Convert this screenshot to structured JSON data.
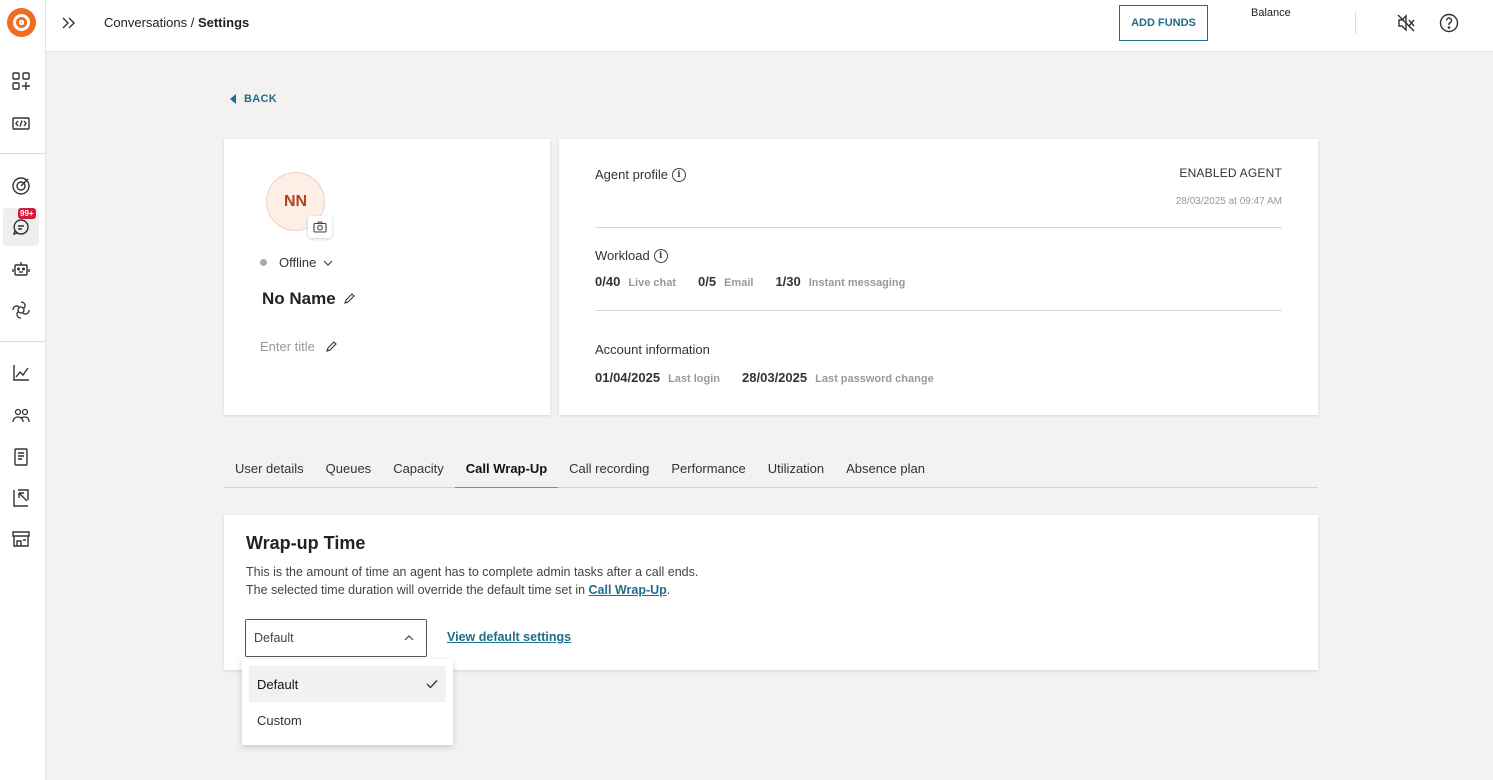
{
  "topbar": {
    "breadcrumb_parent": "Conversations",
    "breadcrumb_separator": " / ",
    "breadcrumb_current": "Settings",
    "add_funds_label": "ADD FUNDS",
    "balance_label": "Balance"
  },
  "sidebar": {
    "badge": "99+",
    "items": [
      "dashboard-icon",
      "code-icon",
      "target-icon",
      "chat-icon",
      "bot-icon",
      "ai-icon",
      "chart-icon",
      "people-icon",
      "book-icon",
      "export-icon",
      "store-icon"
    ]
  },
  "back_label": "BACK",
  "profile": {
    "initials": "NN",
    "status": "Offline",
    "name": "No Name",
    "title_placeholder": "Enter title"
  },
  "info": {
    "agent_profile_label": "Agent profile",
    "enabled_label": "ENABLED AGENT",
    "enabled_date": "28/03/2025 at 09:47 AM",
    "workload_label": "Workload",
    "workload": [
      {
        "value": "0/40",
        "label": "Live chat"
      },
      {
        "value": "0/5",
        "label": "Email"
      },
      {
        "value": "1/30",
        "label": "Instant messaging"
      }
    ],
    "account_label": "Account information",
    "account": [
      {
        "value": "01/04/2025",
        "label": "Last login"
      },
      {
        "value": "28/03/2025",
        "label": "Last password change"
      }
    ]
  },
  "tabs": [
    "User details",
    "Queues",
    "Capacity",
    "Call Wrap-Up",
    "Call recording",
    "Performance",
    "Utilization",
    "Absence plan"
  ],
  "active_tab": "Call Wrap-Up",
  "wrapup": {
    "title": "Wrap-up Time",
    "desc_line1": "This is the amount of time an agent has to complete admin tasks after a call ends.",
    "desc_line2_prefix": "The selected time duration will override the default time set in ",
    "desc_link": "Call Wrap-Up",
    "desc_line2_suffix": ".",
    "select_value": "Default",
    "view_default_link": "View default settings",
    "options": [
      "Default",
      "Custom"
    ]
  },
  "colors": {
    "accent": "#f26b21",
    "link": "#1e6d8a",
    "badge": "#d31c3a"
  }
}
